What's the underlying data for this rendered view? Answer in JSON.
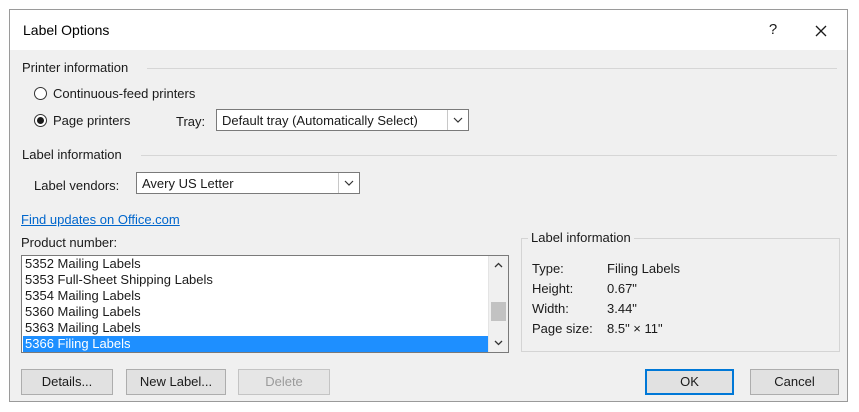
{
  "window": {
    "title": "Label Options",
    "help_label": "?",
    "close_label": "✕"
  },
  "printer_info": {
    "heading": "Printer information",
    "continuous_label": "Continuous-feed printers",
    "page_label": "Page printers",
    "selected": "page",
    "tray_label": "Tray:",
    "tray_value": "Default tray (Automatically Select)"
  },
  "label_info_section": {
    "heading": "Label information",
    "vendors_label": "Label vendors:",
    "vendors_value": "Avery US Letter",
    "updates_link": "Find updates on Office.com"
  },
  "product": {
    "label": "Product number:",
    "items": [
      "5352 Mailing Labels",
      "5353 Full-Sheet Shipping Labels",
      "5354 Mailing Labels",
      "5360 Mailing Labels",
      "5363 Mailing Labels",
      "5366 Filing Labels"
    ],
    "selected_index": 5
  },
  "label_details": {
    "heading": "Label information",
    "rows": [
      {
        "key": "Type:",
        "value": "Filing Labels"
      },
      {
        "key": "Height:",
        "value": "0.67\""
      },
      {
        "key": "Width:",
        "value": "3.44\""
      },
      {
        "key": "Page size:",
        "value": "8.5\" × 11\""
      }
    ]
  },
  "buttons": {
    "details": "Details...",
    "new_label": "New Label...",
    "delete": "Delete",
    "ok": "OK",
    "cancel": "Cancel"
  },
  "colors": {
    "selection": "#1e8fff",
    "link": "#0066cc",
    "default_button_border": "#0078d7"
  }
}
